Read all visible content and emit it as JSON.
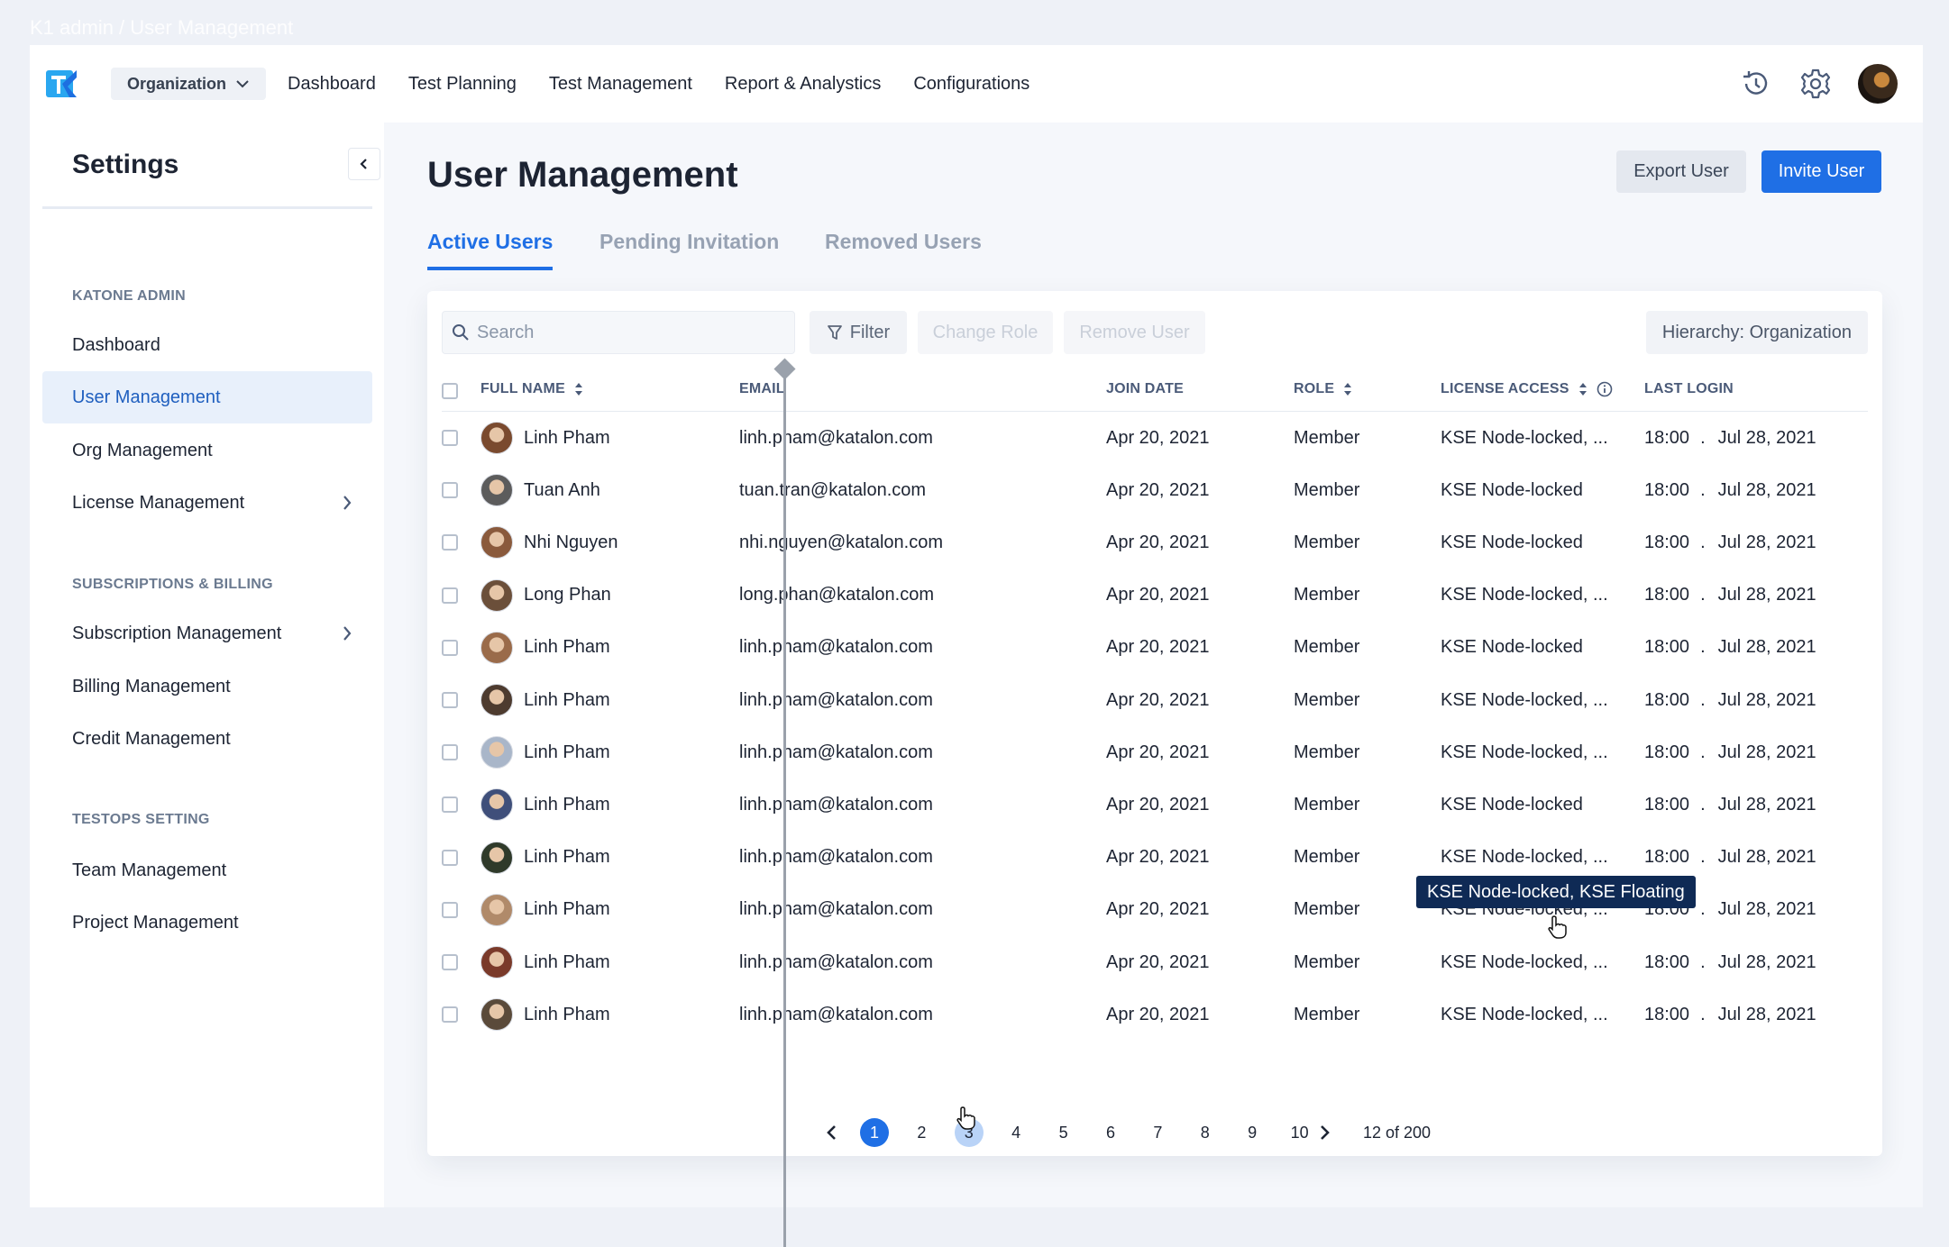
{
  "breadcrumb": "K1 admin / User Management",
  "topbar": {
    "org_select": "Organization",
    "nav": [
      "Dashboard",
      "Test Planning",
      "Test Management",
      "Report & Analystics",
      "Configurations"
    ]
  },
  "sidebar": {
    "title": "Settings",
    "sections": [
      {
        "label": "KATONE ADMIN"
      },
      {
        "label": "SUBSCRIPTIONS & BILLING"
      },
      {
        "label": "TESTOPS SETTING"
      }
    ],
    "items": [
      {
        "label": "Dashboard"
      },
      {
        "label": "User Management"
      },
      {
        "label": "Org Management"
      },
      {
        "label": "License Management"
      },
      {
        "label": "Subscription Management"
      },
      {
        "label": "Billing Management"
      },
      {
        "label": "Credit Management"
      },
      {
        "label": "Team Management"
      },
      {
        "label": "Project Management"
      }
    ]
  },
  "main": {
    "title": "User Management",
    "export_label": "Export User",
    "invite_label": "Invite User",
    "tabs": [
      "Active Users",
      "Pending Invitation",
      "Removed Users"
    ],
    "search_placeholder": "Search",
    "filter_label": "Filter",
    "change_role_label": "Change Role",
    "remove_user_label": "Remove User",
    "hierarchy_label": "Hierarchy: Organization",
    "columns": [
      "FULL NAME",
      "EMAIL",
      "JOIN DATE",
      "ROLE",
      "LICENSE ACCESS",
      "LAST LOGIN"
    ],
    "rows": [
      {
        "name": "Linh Pham",
        "email": "linh.pham@katalon.com",
        "join": "Apr 20, 2021",
        "role": "Member",
        "license": "KSE Node-locked, ...",
        "time": "18:00",
        "date": "Jul 28, 2021"
      },
      {
        "name": "Tuan Anh",
        "email": "tuan.tran@katalon.com",
        "join": "Apr 20, 2021",
        "role": "Member",
        "license": "KSE Node-locked",
        "time": "18:00",
        "date": "Jul 28, 2021"
      },
      {
        "name": "Nhi Nguyen",
        "email": "nhi.nguyen@katalon.com",
        "join": "Apr 20, 2021",
        "role": "Member",
        "license": "KSE Node-locked",
        "time": "18:00",
        "date": "Jul 28, 2021"
      },
      {
        "name": "Long Phan",
        "email": "long.phan@katalon.com",
        "join": "Apr 20, 2021",
        "role": "Member",
        "license": "KSE Node-locked, ...",
        "time": "18:00",
        "date": "Jul 28, 2021"
      },
      {
        "name": "Linh Pham",
        "email": "linh.pham@katalon.com",
        "join": "Apr 20, 2021",
        "role": "Member",
        "license": "KSE Node-locked",
        "time": "18:00",
        "date": "Jul 28, 2021"
      },
      {
        "name": "Linh Pham",
        "email": "linh.pham@katalon.com",
        "join": "Apr 20, 2021",
        "role": "Member",
        "license": "KSE Node-locked, ...",
        "time": "18:00",
        "date": "Jul 28, 2021"
      },
      {
        "name": "Linh Pham",
        "email": "linh.pham@katalon.com",
        "join": "Apr 20, 2021",
        "role": "Member",
        "license": "KSE Node-locked, ...",
        "time": "18:00",
        "date": "Jul 28, 2021"
      },
      {
        "name": "Linh Pham",
        "email": "linh.pham@katalon.com",
        "join": "Apr 20, 2021",
        "role": "Member",
        "license": "KSE Node-locked",
        "time": "18:00",
        "date": "Jul 28, 2021"
      },
      {
        "name": "Linh Pham",
        "email": "linh.pham@katalon.com",
        "join": "Apr 20, 2021",
        "role": "Member",
        "license": "KSE Node-locked, ...",
        "time": "18:00",
        "date": "Jul 28, 2021"
      },
      {
        "name": "Linh Pham",
        "email": "linh.pham@katalon.com",
        "join": "Apr 20, 2021",
        "role": "Member",
        "license": "KSE Node-locked, ...",
        "time": "18:00",
        "date": "Jul 28, 2021"
      },
      {
        "name": "Linh Pham",
        "email": "linh.pham@katalon.com",
        "join": "Apr 20, 2021",
        "role": "Member",
        "license": "KSE Node-locked, ...",
        "time": "18:00",
        "date": "Jul 28, 2021"
      },
      {
        "name": "Linh Pham",
        "email": "linh.pham@katalon.com",
        "join": "Apr 20, 2021",
        "role": "Member",
        "license": "KSE Node-locked, ...",
        "time": "18:00",
        "date": "Jul 28, 2021"
      }
    ],
    "tooltip": "KSE Node-locked, KSE Floating",
    "pagination": {
      "pages": [
        "1",
        "2",
        "3",
        "4",
        "5",
        "6",
        "7",
        "8",
        "9",
        "10"
      ],
      "current": "1",
      "hovered": "3",
      "count": "12 of 200"
    }
  },
  "colors": {
    "accent": "#1f6fe5",
    "tooltip_bg": "#0f2a55",
    "active_sidebar_bg": "#e8f0fb"
  },
  "icons": [
    "katalon-logo-icon",
    "chevron-down-icon",
    "history-icon",
    "gear-icon",
    "chevron-left-icon",
    "chevron-right-icon",
    "search-icon",
    "filter-icon",
    "sort-icon",
    "info-icon",
    "hand-cursor-icon"
  ]
}
